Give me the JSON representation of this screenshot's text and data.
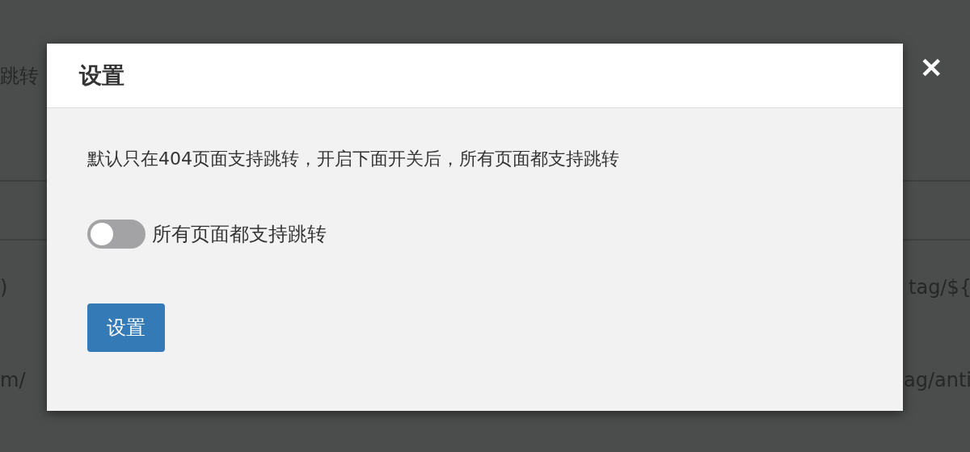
{
  "background": {
    "heading": "跳转",
    "rows": [
      {
        "column_1": ")",
        "column_2": "tag/${"
      },
      {
        "column_1": "m/",
        "column_2": "ag/anti"
      }
    ]
  },
  "dialog": {
    "title": "设置",
    "close": "✕",
    "description": "默认只在404页面支持跳转，开启下面开关后，所有页面都支持跳转",
    "toggle": {
      "label": "所有页面都支持跳转",
      "on": false
    },
    "button": "设置"
  }
}
